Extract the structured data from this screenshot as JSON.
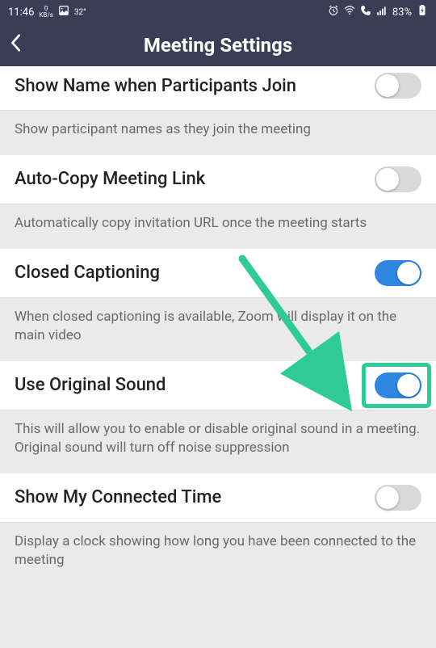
{
  "statusbar": {
    "time": "11:46",
    "kbps_value": "0",
    "kbps_unit": "KB/s",
    "temp": "32°",
    "battery": "83%"
  },
  "header": {
    "title": "Meeting Settings"
  },
  "settings": [
    {
      "label": "Show Name when Participants Join",
      "desc": "Show participant names as they join the meeting",
      "enabled": false
    },
    {
      "label": "Auto-Copy Meeting Link",
      "desc": "Automatically copy invitation URL once the meeting starts",
      "enabled": false
    },
    {
      "label": "Closed Captioning",
      "desc": "When closed captioning is available, Zoom will display it on the main video",
      "enabled": true
    },
    {
      "label": "Use Original Sound",
      "desc": "This will allow you to enable or disable original sound in a meeting. Original sound will turn off noise suppression",
      "enabled": true
    },
    {
      "label": "Show My Connected Time",
      "desc": "Display a clock showing how long you have been connected to the meeting",
      "enabled": false
    }
  ],
  "annotation": {
    "highlighted_setting_index": 3,
    "arrow_color": "#2fcb97"
  }
}
